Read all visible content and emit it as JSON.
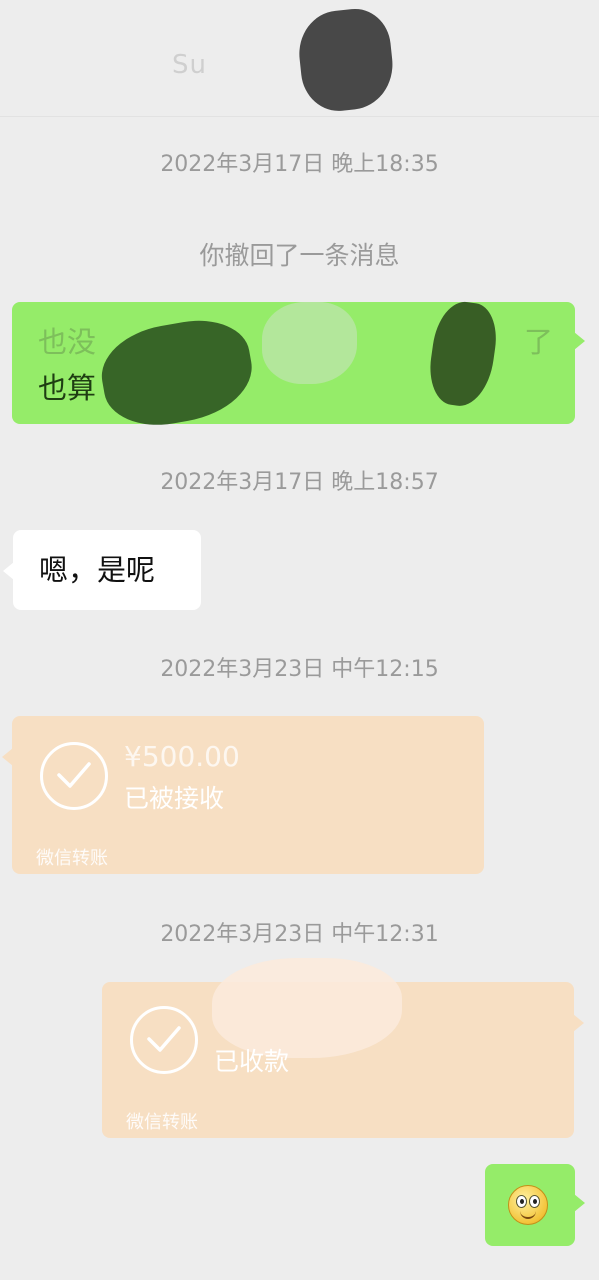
{
  "header": {
    "title_partial": "Su"
  },
  "messages": {
    "ts1": "2022年3月17日 晚上18:35",
    "recalled": "你撤回了一条消息",
    "green_line1": "也没",
    "green_line1_end": "了",
    "green_line2": "也算",
    "ts2": "2022年3月17日 晚上18:57",
    "reply": "嗯，是呢",
    "ts3": "2022年3月23日 中午12:15",
    "transfer1": {
      "amount": "¥500.00",
      "status": "已被接收",
      "label": "微信转账"
    },
    "ts4": "2022年3月23日 中午12:31",
    "transfer2": {
      "status": "已收款",
      "label": "微信转账"
    },
    "emoji": "smiley-emoji"
  },
  "colors": {
    "background": "#ededed",
    "green_bubble": "#95ec69",
    "white_bubble": "#ffffff",
    "transfer_bubble": "#f7dfc3",
    "timestamp_text": "#9a9a9a"
  }
}
